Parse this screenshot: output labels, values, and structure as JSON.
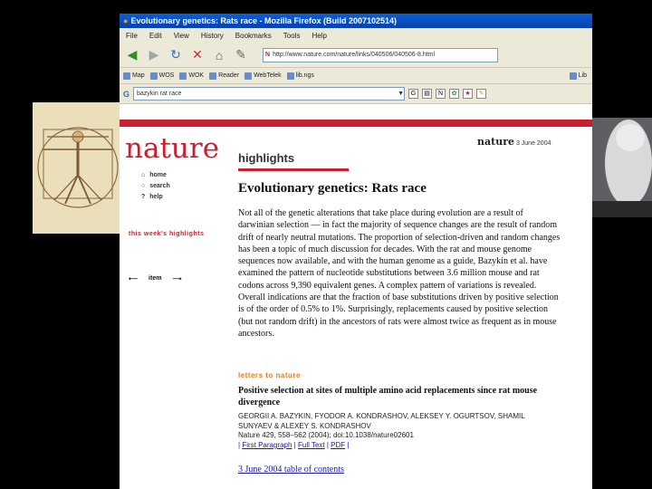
{
  "window": {
    "title": "Evolutionary genetics: Rats race - Mozilla Firefox (Build 2007102514)"
  },
  "menu": [
    "File",
    "Edit",
    "View",
    "History",
    "Bookmarks",
    "Tools",
    "Help"
  ],
  "url": "http://www.nature.com/nature/links/040506/040506-8.html",
  "bookmarks": [
    "Map",
    "WOS",
    "WOK",
    "Reader",
    "WebTelek",
    "lib.ngs",
    "Lib"
  ],
  "search": {
    "value": "bazykin rat race"
  },
  "page": {
    "logo": "nature",
    "nav": {
      "home": "home",
      "search": "search",
      "help": "help"
    },
    "week_highlights": "this week's highlights",
    "item": "item",
    "section": "highlights",
    "issue_brand": "nature",
    "issue_date": "3 June 2004",
    "headline": "Evolutionary genetics: Rats race",
    "body": "Not all of the genetic alterations that take place during evolution are a result of darwinian selection — in fact the majority of sequence changes are the result of random drift of nearly neutral mutations. The proportion of selection-driven and random changes has been a topic of much discussion for decades. With the rat and mouse genome sequences now available, and with the human genome as a guide, Bazykin et al. have examined the pattern of nucleotide substitutions between 3.6 million mouse and rat codons across 9,390 equivalent genes. A complex pattern of variations is revealed. Overall indications are that the fraction of base substitutions driven by positive selection is of the order of 0.5% to 1%. Surprisingly, replacements caused by positive selection (but not random drift) in the ancestors of rats were almost twice as frequent as in mouse ancestors.",
    "letters": "letters to nature",
    "article_title": "Positive selection at sites of multiple amino acid replacements since rat mouse divergence",
    "authors": "GEORGII A. BAZYKIN, FYODOR A. KONDRASHOV, ALEKSEY Y. OGURTSOV, SHAMIL SUNYAEV & ALEXEY S. KONDRASHOV",
    "citation": "Nature 429, 558–562 (2004); doi:10.1038/nature02601",
    "link_first": "First Paragraph",
    "link_full": "Full Text",
    "link_pdf": "PDF",
    "toc": "3 June 2004 table of contents"
  }
}
